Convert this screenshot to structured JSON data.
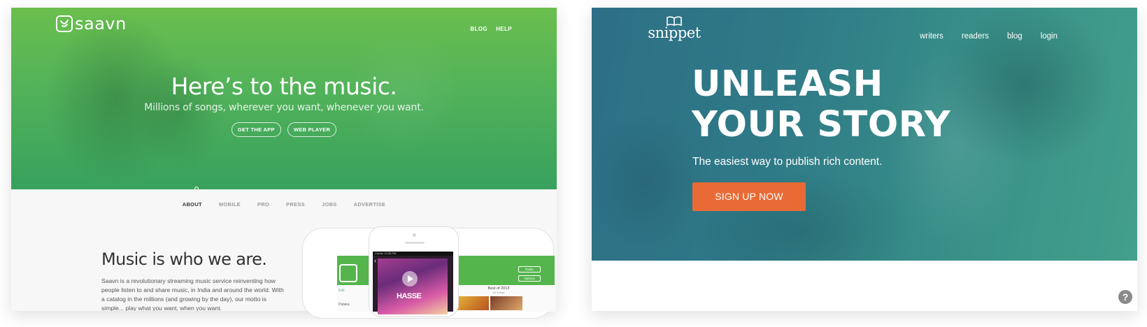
{
  "saavn": {
    "brand": "saavn",
    "nav": [
      "BLOG",
      "HELP"
    ],
    "headline": "Here’s to the music.",
    "subheadline": "Millions of songs, wherever you want, whenever you want.",
    "buttons": {
      "get_app": "GET THE APP",
      "web_player": "WEB PLAYER"
    },
    "tabs": [
      "ABOUT",
      "MOBILE",
      "PRO",
      "PRESS",
      "JOBS",
      "ADVERTISE"
    ],
    "active_tab": "ABOUT",
    "section_title": "Music is who we are.",
    "section_copy": "Saavn is a revolutionary streaming music service reinventing how people listen to and share music, in India and around the world. With a catalog in the millions (and growing by the day), our motto is simple... play what you want, when you want.",
    "phone": {
      "status_carrier": "Carrier",
      "status_time": "10:38 PM",
      "left_tabs": "Edit",
      "album_title": "HASSE",
      "right_buttons": [
        "Radio",
        "Options"
      ],
      "playlist_title": "Best of 2013",
      "playlist_count": "40 Songs",
      "song_name": "Pataka"
    },
    "colors": {
      "hero_top": "#62bb44",
      "hero_bottom": "#3bab63"
    }
  },
  "snippet": {
    "brand": "snippet",
    "nav": [
      "writers",
      "readers",
      "blog",
      "login"
    ],
    "headline_line1": "UNLEASH",
    "headline_line2": "YOUR STORY",
    "subheadline": "The easiest way to publish rich content.",
    "cta": "SIGN UP NOW",
    "help": "?",
    "colors": {
      "cta": "#e96a34",
      "hero": "#2f7a87"
    }
  }
}
